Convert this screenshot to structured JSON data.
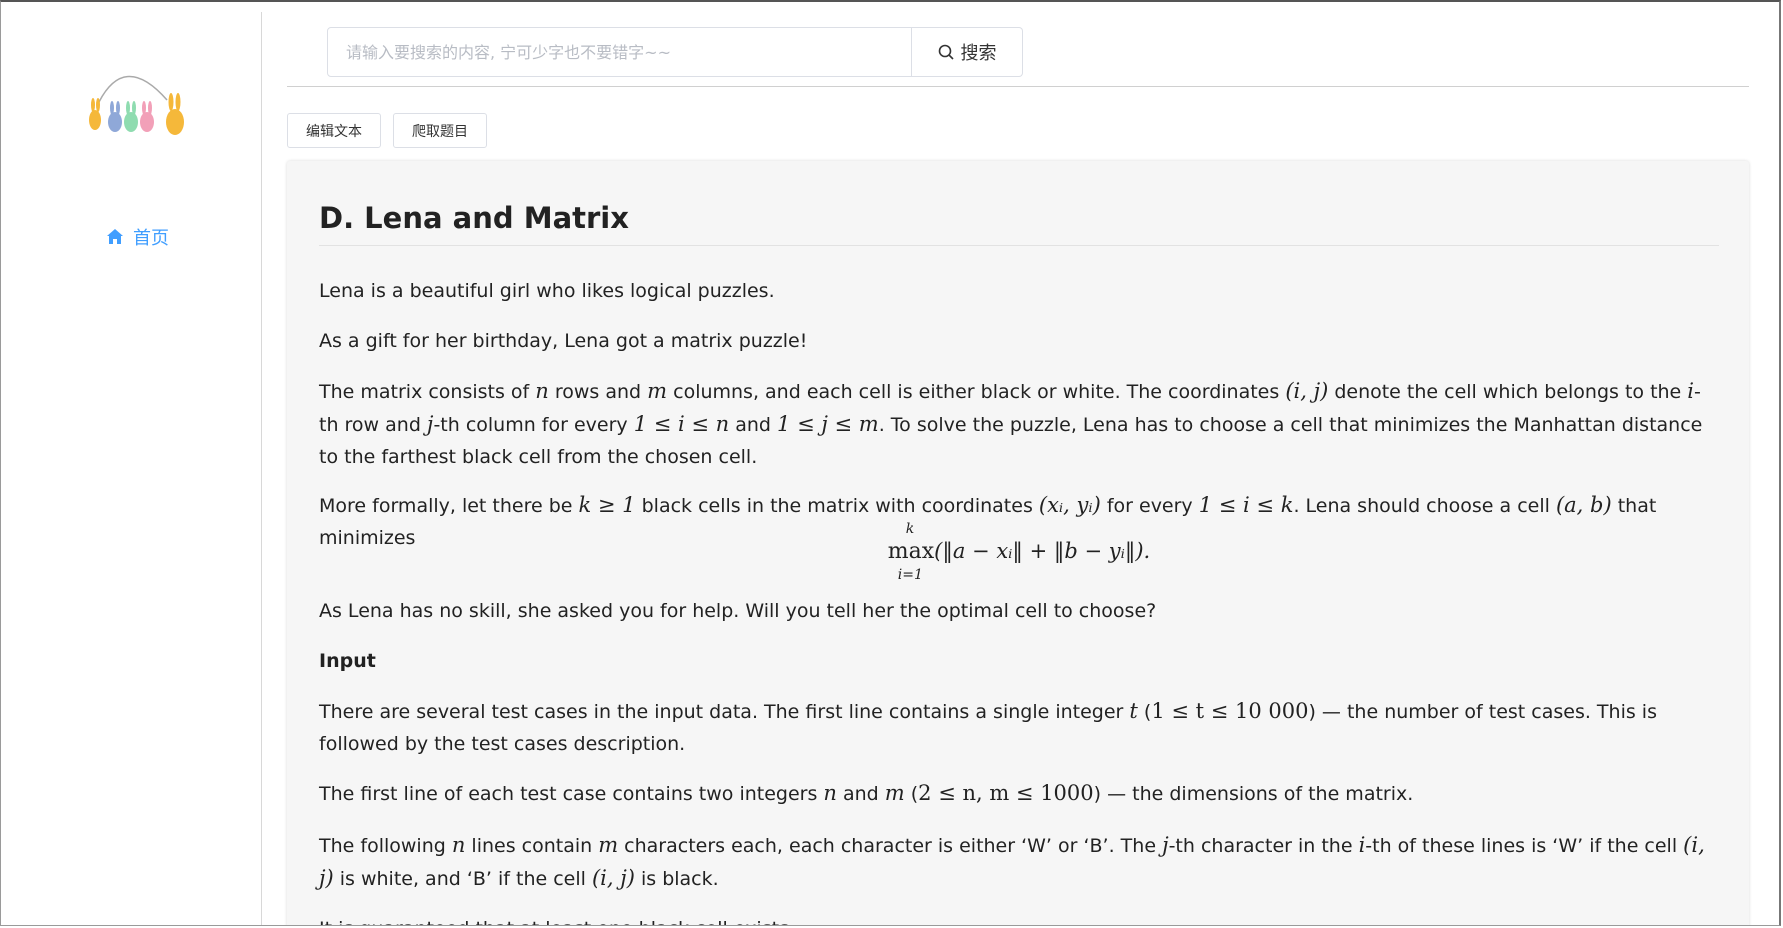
{
  "sidebar": {
    "logo_alt": "bunnies-logo",
    "nav": [
      {
        "label": "首页",
        "icon": "home-icon",
        "color": "#409eff"
      }
    ]
  },
  "search": {
    "placeholder": "请输入要搜索的内容, 宁可少字也不要错字~~",
    "value": "",
    "button_label": "搜索",
    "button_icon": "search-icon"
  },
  "toolbar": {
    "edit_label": "编辑文本",
    "fetch_label": "爬取题目"
  },
  "problem": {
    "title": "D. Lena and Matrix",
    "p1": "Lena is a beautiful girl who likes logical puzzles.",
    "p2": "As a gift for her birthday, Lena got a matrix puzzle!",
    "p3": {
      "a": "The matrix consists of ",
      "n": "n",
      "b": " rows and ",
      "m": "m",
      "c": " columns, and each cell is either black or white. The coordinates ",
      "ij": "(i, j)",
      "d": " denote the cell which belongs to the ",
      "i": "i",
      "e": "-th row and ",
      "j": "j",
      "f": "-th column for every ",
      "ineq1": "1 ≤ i ≤ n",
      "g": " and ",
      "ineq2": "1 ≤ j ≤ m",
      "h": ". To solve the puzzle, Lena has to choose a cell that minimizes the Manhattan distance to the farthest black cell from the chosen cell."
    },
    "p4": {
      "a": "More formally, let there be ",
      "k": "k ≥ 1",
      "b": " black cells in the matrix with coordinates ",
      "xy": "(xᵢ, yᵢ)",
      "c": " for every ",
      "ineq": "1 ≤ i ≤ k",
      "d": ". Lena should choose a cell ",
      "ab": "(a, b)",
      "e": " that minimizes"
    },
    "formula": {
      "op": "max",
      "sup": "k",
      "sub": "i=1",
      "body": "(‖a − xᵢ‖ + ‖b − yᵢ‖)."
    },
    "p5": "As Lena has no skill, she asked you for help. Will you tell her the optimal cell to choose?",
    "input_heading": "Input",
    "p6": {
      "a": "There are several test cases in the input data. The first line contains a single integer ",
      "t": "t",
      "b": " (",
      "ineq": "1 ≤ t ≤ 10 000",
      "c": ") — the number of test cases. This is followed by the test cases description."
    },
    "p7": {
      "a": "The first line of each test case contains two integers ",
      "n": "n",
      "b": " and ",
      "m": "m",
      "c": " (",
      "ineq": "2 ≤ n, m ≤ 1000",
      "d": ")  — the dimensions of the matrix."
    },
    "p8": {
      "a": "The following ",
      "n": "n",
      "b": " lines contain ",
      "m": "m",
      "c": " characters each, each character is either ‘W’ or ‘B’. The ",
      "j": "j",
      "d": "-th character in the ",
      "i": "i",
      "e": "-th of these lines is ‘W’ if the cell ",
      "ij": "(i, j)",
      "f": " is white, and ‘B’ if the cell ",
      "ij2": "(i, j)",
      "g": " is black."
    },
    "p9": "It is guaranteed that at least one black cell exists."
  }
}
